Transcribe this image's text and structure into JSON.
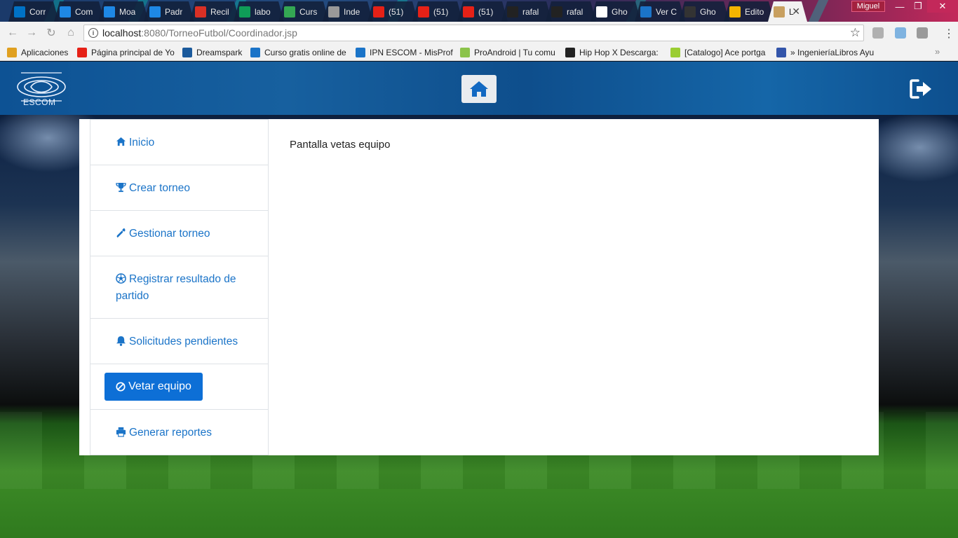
{
  "browser": {
    "tabs": [
      {
        "title": "Corr",
        "icon": "outlook-icon",
        "color": "#0072c6"
      },
      {
        "title": "Com",
        "icon": "classroom-icon",
        "color": "#1e88e5"
      },
      {
        "title": "Moa",
        "icon": "classroom-icon",
        "color": "#1e88e5"
      },
      {
        "title": "Padr",
        "icon": "classroom-icon",
        "color": "#1e88e5"
      },
      {
        "title": "Recil",
        "icon": "gmail-icon",
        "color": "#d93025"
      },
      {
        "title": "labo",
        "icon": "drive-icon",
        "color": "#0f9d58"
      },
      {
        "title": "Curs",
        "icon": "c-icon",
        "color": "#34a853"
      },
      {
        "title": "Inde",
        "icon": "page-icon",
        "color": "#999999"
      },
      {
        "title": "(51)",
        "icon": "youtube-icon",
        "color": "#e62117"
      },
      {
        "title": "(51)",
        "icon": "youtube-icon",
        "color": "#e62117"
      },
      {
        "title": "(51)",
        "icon": "youtube-icon",
        "color": "#e62117"
      },
      {
        "title": "rafal",
        "icon": "github-icon",
        "color": "#222222"
      },
      {
        "title": "rafal",
        "icon": "github-icon",
        "color": "#222222"
      },
      {
        "title": "Gho",
        "icon": "wikipedia-icon",
        "color": "#ffffff"
      },
      {
        "title": "Ver C",
        "icon": "edge-icon",
        "color": "#1b74c8"
      },
      {
        "title": "Gho",
        "icon": "youtube-icon",
        "color": "#333333"
      },
      {
        "title": "Edito",
        "icon": "chrome-icon",
        "color": "#f4b400"
      },
      {
        "title": "L",
        "icon": "image-icon",
        "color": "#c8a060",
        "active": true
      }
    ],
    "profile_name": "Miguel",
    "url_host": "localhost",
    "url_path": ":8080/TorneoFutbol/Coordinador.jsp",
    "bookmarks": [
      {
        "label": "Aplicaciones",
        "icon": "apps-icon",
        "color": "#e0a020"
      },
      {
        "label": "Página principal de Yo",
        "icon": "youtube-icon",
        "color": "#e62117"
      },
      {
        "label": "Dreamspark",
        "icon": "dreamspark-icon",
        "color": "#1b5a9c"
      },
      {
        "label": "Curso gratis online de",
        "icon": "trophy-icon",
        "color": "#1b74c8"
      },
      {
        "label": "IPN ESCOM - MisProf",
        "icon": "check-icon",
        "color": "#1b74c8"
      },
      {
        "label": "ProAndroid | Tu comu",
        "icon": "android-icon",
        "color": "#8bc34a"
      },
      {
        "label": "Hip Hop X Descarga:",
        "icon": "hiphop-icon",
        "color": "#222222"
      },
      {
        "label": "[Catalogo] Ace portga",
        "icon": "plus-icon",
        "color": "#9acd32"
      },
      {
        "label": "» IngenieríaLibros Ayu",
        "icon": "triangle-icon",
        "color": "#3355aa"
      }
    ]
  },
  "app": {
    "logo_text": "ESCOM",
    "menu": [
      {
        "label": "Inicio",
        "icon": "home-icon",
        "active": false
      },
      {
        "label": "Crear torneo",
        "icon": "trophy-icon",
        "active": false
      },
      {
        "label": "Gestionar torneo",
        "icon": "wrench-icon",
        "active": false
      },
      {
        "label": "Registrar resultado de",
        "label2": "partido",
        "icon": "soccer-ball-icon",
        "active": false
      },
      {
        "label": "Solicitudes pendientes",
        "icon": "bell-icon",
        "active": false
      },
      {
        "label": "Vetar equipo",
        "icon": "ban-icon",
        "active": true
      },
      {
        "label": "Generar reportes",
        "icon": "print-icon",
        "active": false
      }
    ],
    "main_text": "Pantalla vetas equipo"
  }
}
